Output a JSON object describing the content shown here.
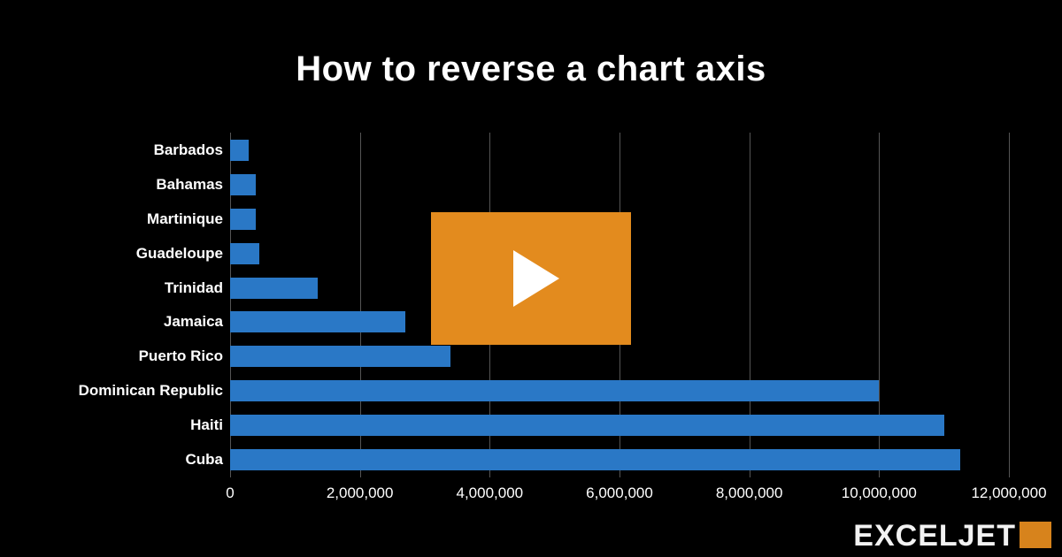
{
  "title": "How to reverse a chart axis",
  "brand": "EXCELJET",
  "chart_data": {
    "type": "bar",
    "orientation": "horizontal",
    "categories": [
      "Barbados",
      "Bahamas",
      "Martinique",
      "Guadeloupe",
      "Trinidad",
      "Jamaica",
      "Puerto Rico",
      "Dominican Republic",
      "Haiti",
      "Cuba"
    ],
    "values": [
      280000,
      390000,
      400000,
      450000,
      1350000,
      2700000,
      3400000,
      10000000,
      11000000,
      11250000
    ],
    "xlabel": "",
    "ylabel": "",
    "xlim": [
      0,
      12000000
    ],
    "x_ticks": [
      0,
      2000000,
      4000000,
      6000000,
      8000000,
      10000000,
      12000000
    ],
    "x_tick_labels": [
      "0",
      "2,000,000",
      "4,000,000",
      "6,000,000",
      "8,000,000",
      "10,000,000",
      "12,000,000"
    ],
    "bar_color": "#2a78c6",
    "grid": true
  },
  "play_button_color": "#e38b1e"
}
